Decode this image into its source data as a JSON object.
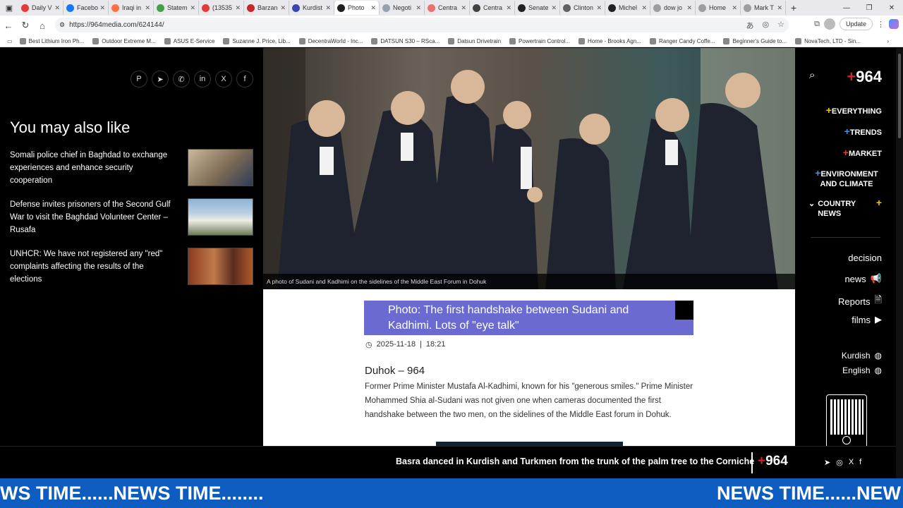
{
  "browser": {
    "tabs": [
      {
        "label": "Daily V",
        "color": "#e53935"
      },
      {
        "label": "Facebo",
        "color": "#1877f2"
      },
      {
        "label": "Iraqi in",
        "color": "#ff7043"
      },
      {
        "label": "Statem",
        "color": "#43a047"
      },
      {
        "label": "(13535",
        "color": "#e53935"
      },
      {
        "label": "Barzan",
        "color": "#c62828"
      },
      {
        "label": "Kurdist",
        "color": "#3949ab"
      },
      {
        "label": "Photo",
        "color": "#212121"
      },
      {
        "label": "Negoti",
        "color": "#90a4ae"
      },
      {
        "label": "Centra",
        "color": "#e57373"
      },
      {
        "label": "Centra",
        "color": "#424242"
      },
      {
        "label": "Senate",
        "color": "#212121"
      },
      {
        "label": "Clinton",
        "color": "#616161"
      },
      {
        "label": "Michel",
        "color": "#212121"
      },
      {
        "label": "dow jo",
        "color": "#9e9e9e"
      },
      {
        "label": "Home",
        "color": "#9e9e9e"
      },
      {
        "label": "Mark T",
        "color": "#9e9e9e"
      }
    ],
    "active_tab_index": 7,
    "url": "https://964media.com/624144/",
    "update_label": "Update",
    "bookmarks": [
      "Best Lithium Iron Ph...",
      "Outdoor Extreme M...",
      "ASUS E-Service",
      "Suzanne J. Price, Lib...",
      "DecentraWorld - Inc...",
      "DATSUN S30 – RSca...",
      "Datsun Drivetrain",
      "Powertrain Control...",
      "Home - Brooks Agn...",
      "Ranger Candy Coffe...",
      "Beginner's Guide to...",
      "NovaTech, LTD - Sin..."
    ]
  },
  "left": {
    "share_icons": [
      "P",
      "➤",
      "✆",
      "in",
      "X",
      "f"
    ],
    "heading": "You may also like",
    "related": [
      {
        "title": "Somali police chief in Baghdad to exchange experiences and enhance security cooperation"
      },
      {
        "title": "Defense invites prisoners of the Second Gulf War to visit the Baghdad Volunteer Center – Rusafa"
      },
      {
        "title": "UNHCR: We have not registered any \"red\" complaints affecting the results of the elections"
      }
    ]
  },
  "article": {
    "caption": "A photo of Sudani and Kadhimi on the sidelines of the Middle East Forum in Dohuk",
    "title": "Photo: The first handshake between Sudani and Kadhimi. Lots of \"eye talk\"",
    "date": "2025-11-18",
    "time": "18:21",
    "dateline": "Duhok – 964",
    "body": "Former Prime Minister Mustafa Al-Kadhimi, known for his \"generous smiles.\" Prime Minister Mohammed Shia al-Sudani was not given one when cameras documented the first handshake between the two men, on the sidelines of the Middle East forum in Dohuk."
  },
  "right": {
    "logo": "964",
    "menu": {
      "everything": "EVERYTHING",
      "trends": "TRENDS",
      "market": "MARKET",
      "environment": "ENVIRONMENT AND CLIMATE",
      "country": "COUNTRY NEWS"
    },
    "plus_colors": {
      "everything": "#f5c518",
      "trends": "#4a90e2",
      "market": "#e53935",
      "environment": "#4a90e2",
      "country": "#f5c518"
    },
    "sub": {
      "decision": "decision",
      "news": "news",
      "reports": "Reports",
      "films": "films"
    },
    "langs": {
      "kurdish": "Kurdish",
      "english": "English"
    }
  },
  "bottom": {
    "headline": "Basra danced in Kurdish and Turkmen from the trunk of the palm tree to the Corniche",
    "logo": "964"
  },
  "ticker": {
    "text_left": "WS TIME......NEWS TIME........",
    "text_right": "NEWS TIME......NEW"
  }
}
